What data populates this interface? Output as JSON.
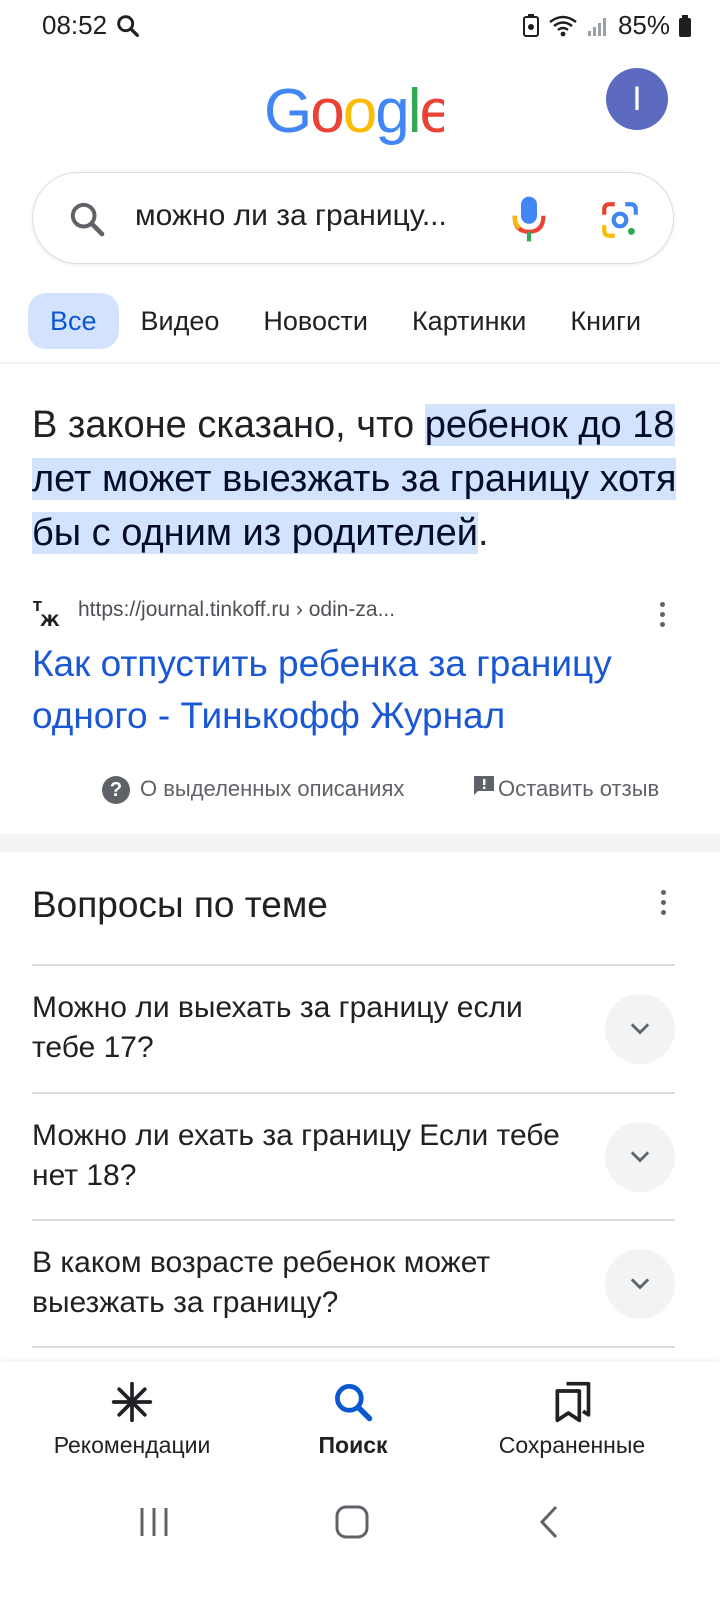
{
  "status_bar": {
    "time": "08:52",
    "battery": "85%"
  },
  "header": {
    "logo_text": "Google",
    "avatar_letter": "I"
  },
  "search": {
    "query": "можно ли за границу..."
  },
  "tabs": [
    {
      "label": "Все",
      "active": true
    },
    {
      "label": "Видео",
      "active": false
    },
    {
      "label": "Новости",
      "active": false
    },
    {
      "label": "Картинки",
      "active": false
    },
    {
      "label": "Книги",
      "active": false
    }
  ],
  "snippet": {
    "prefix": "В законе сказано, что ",
    "highlight": "ребенок до 18 лет может выезжать за границу хотя бы с одним из родителей",
    "suffix": "."
  },
  "result": {
    "url": "https://journal.tinkoff.ru › odin-za...",
    "title": "Как отпустить ребенка за границу одного - Тинькофф Журнал"
  },
  "feedback": {
    "about_label": "О выделенных описаниях",
    "about_icon_glyph": "?",
    "feedback_label": "Оставить отзыв"
  },
  "related_questions": {
    "title": "Вопросы по теме",
    "items": [
      {
        "text": "Можно ли выехать за границу если тебе 17?"
      },
      {
        "text": "Можно ли ехать за границу Если тебе нет 18?"
      },
      {
        "text": "В каком возрасте ребенок может выезжать за границу?"
      }
    ]
  },
  "bottom_nav": {
    "items": [
      {
        "label": "Рекомендации",
        "icon": "asterisk-icon"
      },
      {
        "label": "Поиск",
        "icon": "search-icon",
        "active": true
      },
      {
        "label": "Сохраненные",
        "icon": "bookmarks-icon"
      }
    ]
  },
  "colors": {
    "link_blue": "#1a57d3",
    "highlight_bg": "#d2e3fc",
    "active_tab_bg": "#d3e3fd"
  }
}
